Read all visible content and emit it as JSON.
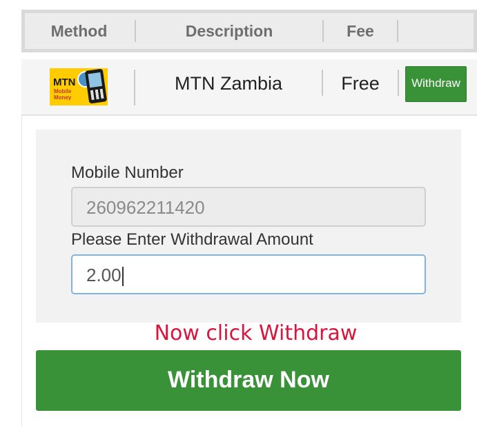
{
  "table_header": {
    "method": "Method",
    "description": "Description",
    "fee": "Fee"
  },
  "method_row": {
    "logo": {
      "brand": "MTN",
      "subtitle_line1": "Mobile",
      "subtitle_line2": "Money",
      "icon": "mtn-mobile-money-logo"
    },
    "description": "MTN Zambia",
    "fee": "Free",
    "action_label": "Withdraw"
  },
  "form": {
    "mobile_label": "Mobile Number",
    "mobile_value": "260962211420",
    "amount_label": "Please Enter Withdrawal Amount",
    "amount_value": "2.00"
  },
  "hint": "Now click Withdraw",
  "submit_label": "Withdraw Now",
  "colors": {
    "button_green": "#3a9238",
    "hint_red": "#dc143c",
    "focus_border": "#7fb2e5"
  }
}
